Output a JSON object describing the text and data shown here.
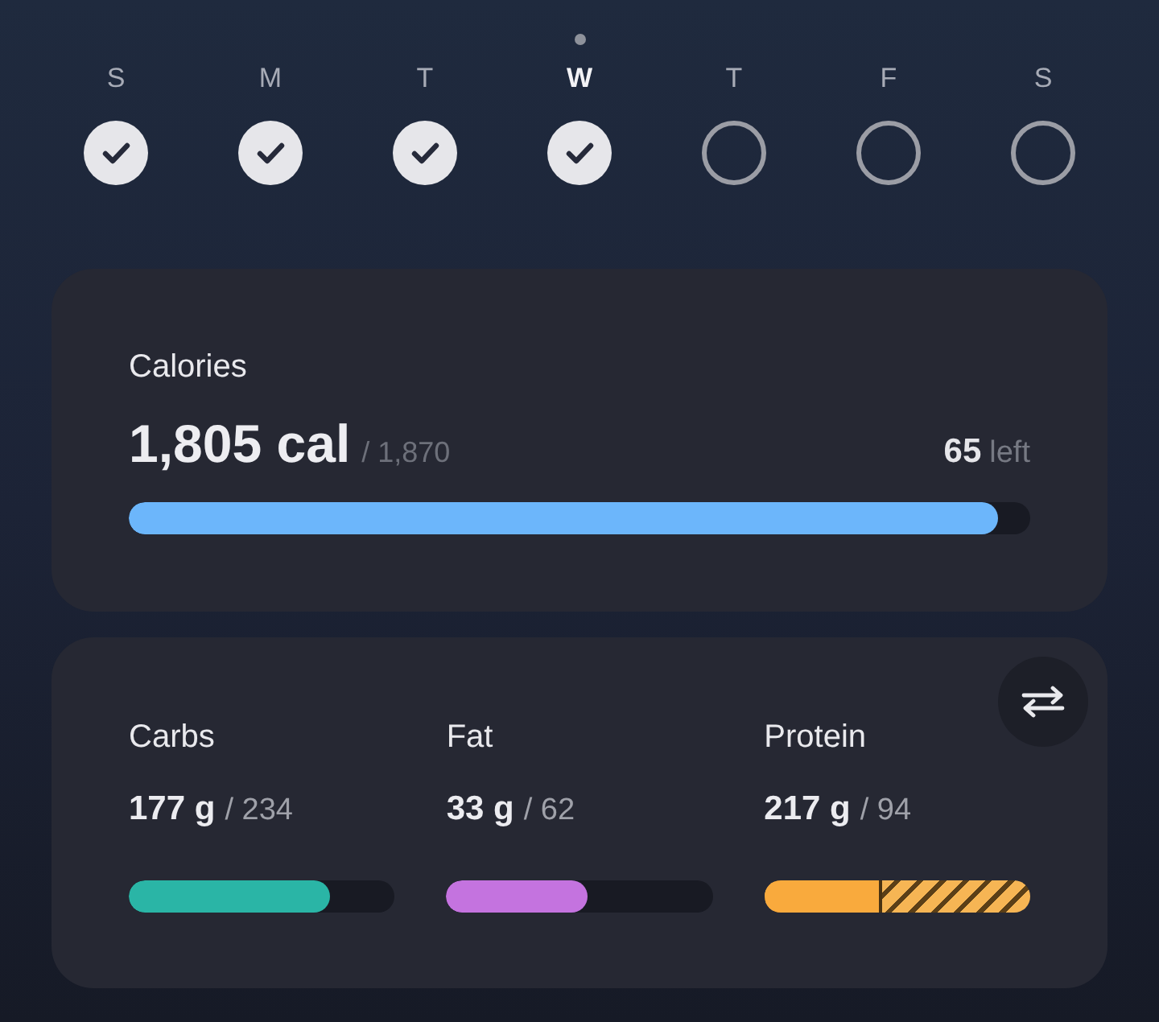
{
  "week": {
    "days": [
      {
        "label": "S",
        "selected": false,
        "checked": true
      },
      {
        "label": "M",
        "selected": false,
        "checked": true
      },
      {
        "label": "T",
        "selected": false,
        "checked": true
      },
      {
        "label": "W",
        "selected": true,
        "checked": true
      },
      {
        "label": "T",
        "selected": false,
        "checked": false
      },
      {
        "label": "F",
        "selected": false,
        "checked": false
      },
      {
        "label": "S",
        "selected": false,
        "checked": false
      }
    ]
  },
  "calories": {
    "title": "Calories",
    "amount": "1,805 cal",
    "goal": "/ 1,870",
    "remaining": "65",
    "remaining_label": "left",
    "level": 0.965
  },
  "macros": {
    "items": [
      {
        "name": "Carbs",
        "amount": "177 g",
        "goal": "/ 234",
        "level": 0.756,
        "overflow": false,
        "color": "#2ab5a6"
      },
      {
        "name": "Fat",
        "amount": "33 g",
        "goal": "/ 62",
        "level": 0.532,
        "overflow": false,
        "color": "#c473df"
      },
      {
        "name": "Protein",
        "amount": "217 g",
        "goal": "/ 94",
        "level": 0.433,
        "overflow": true,
        "color": "#f9aa3d"
      }
    ]
  }
}
